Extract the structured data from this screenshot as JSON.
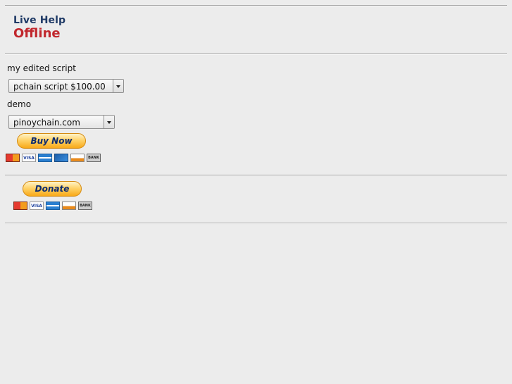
{
  "live_help": {
    "title": "Live Help",
    "status": "Offline"
  },
  "buy_form": {
    "option1_label": "my edited script",
    "option1_selected": "pchain script $100.00",
    "option2_label": "demo",
    "option2_selected": "pinoychain.com",
    "buy_button_label": "Buy Now",
    "card_icons": [
      "mastercard-icon",
      "visa-icon",
      "amex-icon",
      "echeck-icon",
      "discover-icon",
      "bank-icon"
    ]
  },
  "donate_form": {
    "donate_button_label": "Donate",
    "card_icons": [
      "mastercard-icon",
      "visa-icon",
      "amex-icon",
      "discover-icon",
      "bank-icon"
    ]
  },
  "colors": {
    "live_help_title": "#1f3a66",
    "offline": "#c1272d",
    "paypal_button": "#ffc439"
  }
}
